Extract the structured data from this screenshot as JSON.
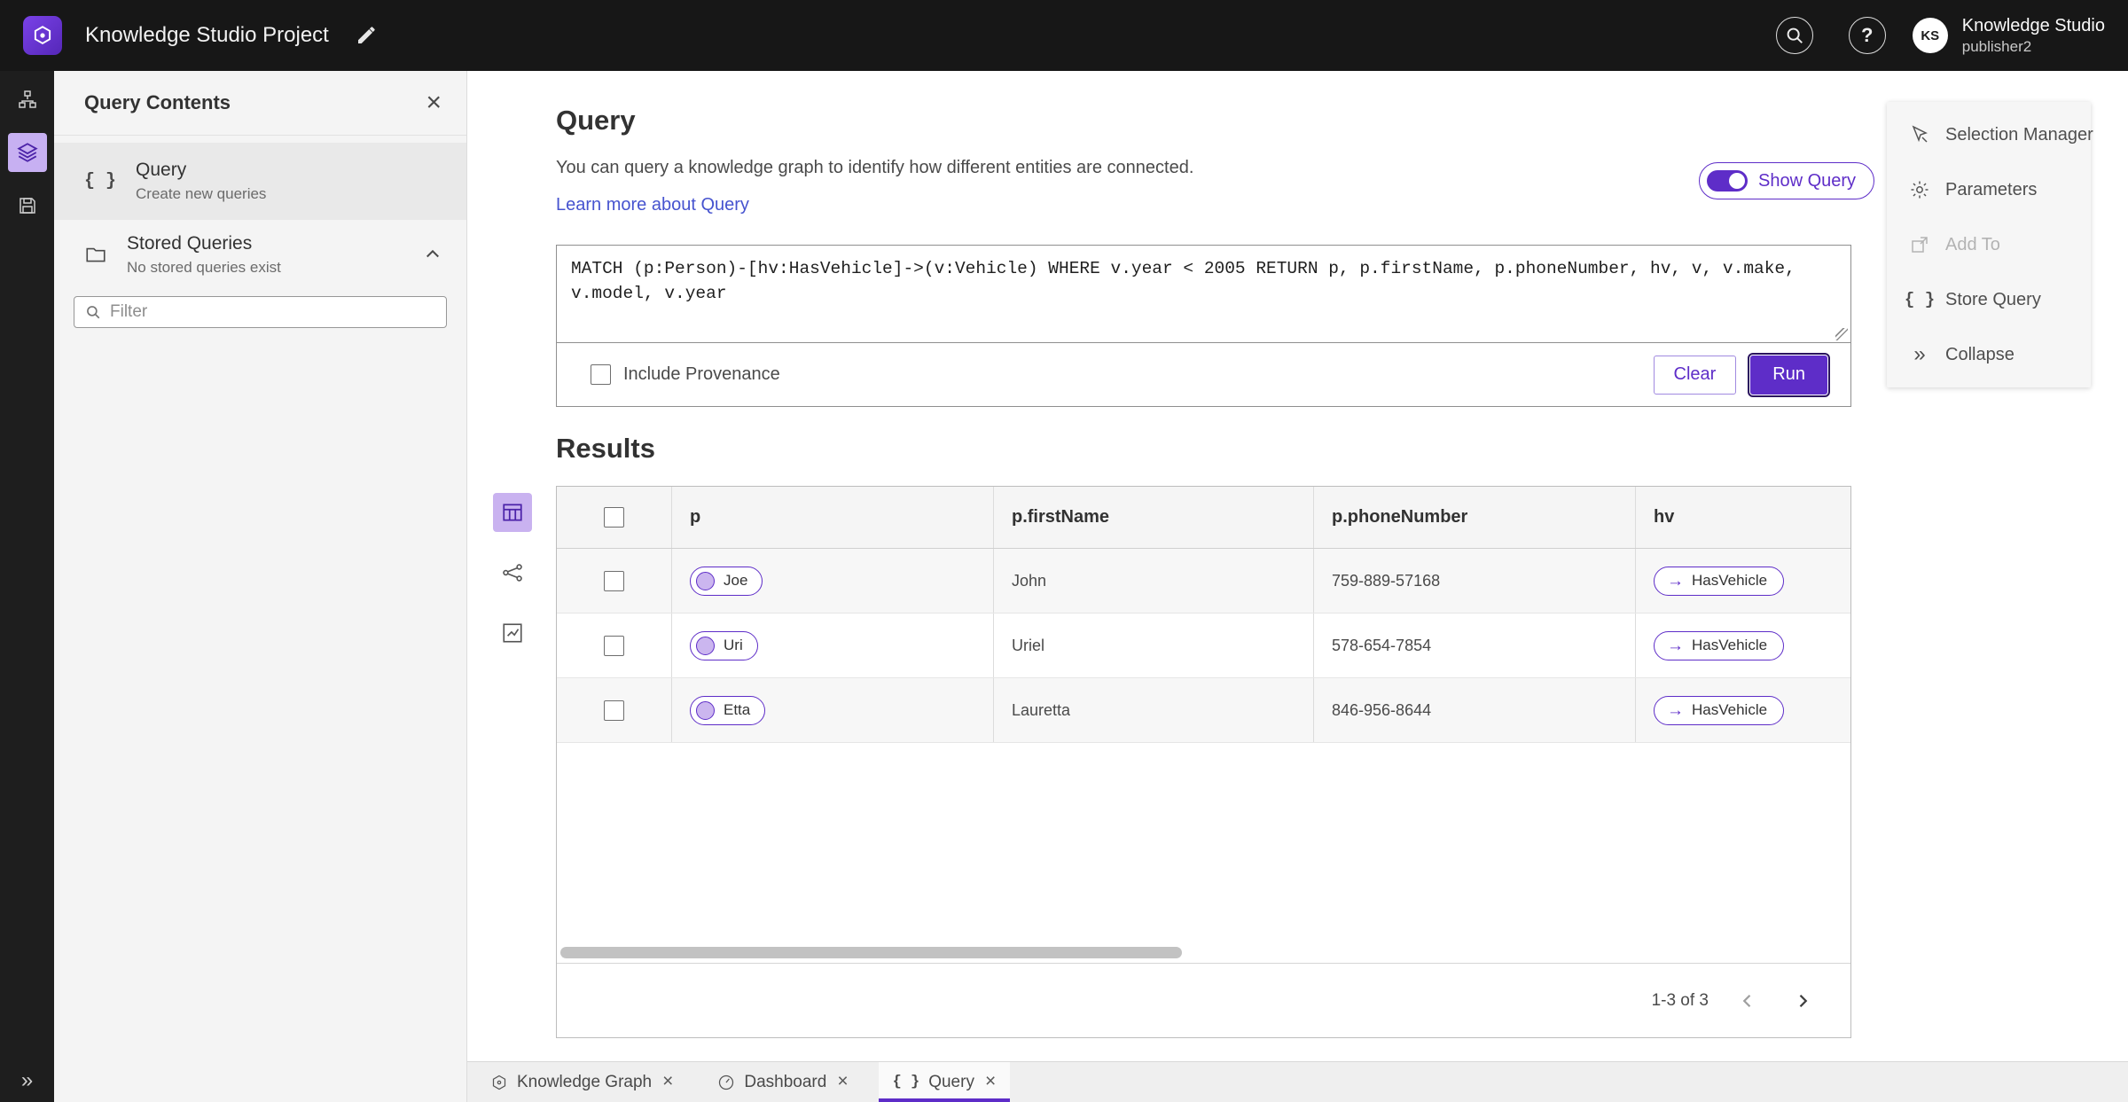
{
  "accent": "#5e2dc8",
  "topbar": {
    "title": "Knowledge Studio Project",
    "user_initials": "KS",
    "user_org": "Knowledge Studio",
    "user_name": "publisher2"
  },
  "left_panel": {
    "title": "Query Contents",
    "query_item": {
      "label": "Query",
      "sublabel": "Create new queries"
    },
    "stored_queries": {
      "label": "Stored Queries",
      "sublabel": "No stored queries exist"
    },
    "filter_placeholder": "Filter"
  },
  "query_section": {
    "title": "Query",
    "description": "You can query a knowledge graph to identify how different entities are connected.",
    "learn_more": "Learn more about Query",
    "show_query": "Show Query",
    "query_text": "MATCH (p:Person)-[hv:HasVehicle]->(v:Vehicle) WHERE v.year < 2005 RETURN p, p.firstName, p.phoneNumber, hv, v, v.make, v.model, v.year",
    "include_provenance": "Include Provenance",
    "clear": "Clear",
    "run": "Run"
  },
  "results": {
    "title": "Results",
    "columns": [
      "p",
      "p.firstName",
      "p.phoneNumber",
      "hv"
    ],
    "arrow": "→",
    "rows": [
      {
        "p": "Joe",
        "firstName": "John",
        "phoneNumber": "759-889-57168",
        "hv": "HasVehicle"
      },
      {
        "p": "Uri",
        "firstName": "Uriel",
        "phoneNumber": "578-654-7854",
        "hv": "HasVehicle"
      },
      {
        "p": "Etta",
        "firstName": "Lauretta",
        "phoneNumber": "846-956-8644",
        "hv": "HasVehicle"
      }
    ],
    "pagination": "1-3 of 3"
  },
  "right_panel": {
    "items": [
      {
        "label": "Selection Manager"
      },
      {
        "label": "Parameters"
      },
      {
        "label": "Add To"
      },
      {
        "label": "Store Query"
      },
      {
        "label": "Collapse"
      }
    ]
  },
  "bottom_tabs": [
    {
      "label": "Knowledge Graph"
    },
    {
      "label": "Dashboard"
    },
    {
      "label": "Query"
    }
  ]
}
